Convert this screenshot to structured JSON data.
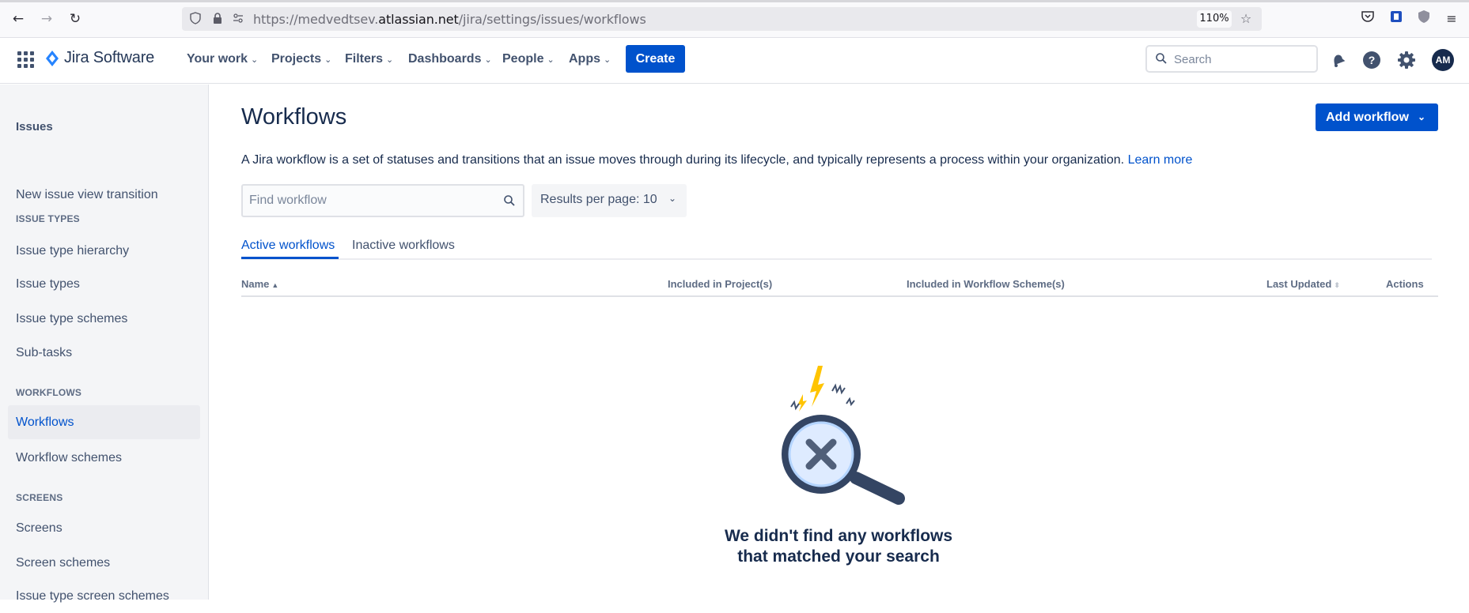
{
  "browser": {
    "url_prefix": "https://medvedtsev.",
    "url_domain": "atlassian.net",
    "url_path": "/jira/settings/issues/workflows",
    "zoom": "110%"
  },
  "topnav": {
    "logo_text": "Jira Software",
    "items": [
      {
        "label": "Your work"
      },
      {
        "label": "Projects"
      },
      {
        "label": "Filters"
      },
      {
        "label": "Dashboards"
      },
      {
        "label": "People"
      },
      {
        "label": "Apps"
      }
    ],
    "create_label": "Create",
    "search_placeholder": "Search",
    "avatar_initials": "AM"
  },
  "sidebar": {
    "title": "Issues",
    "items": [
      {
        "label": "New issue view transition"
      },
      {
        "label": "Issue type hierarchy"
      },
      {
        "label": "Issue types"
      },
      {
        "label": "Issue type schemes"
      },
      {
        "label": "Sub-tasks"
      },
      {
        "label": "Workflows"
      },
      {
        "label": "Workflow schemes"
      },
      {
        "label": "Screens"
      },
      {
        "label": "Screen schemes"
      },
      {
        "label": "Issue type screen schemes"
      }
    ],
    "sections": [
      "ISSUE TYPES",
      "WORKFLOWS",
      "SCREENS"
    ]
  },
  "main": {
    "title": "Workflows",
    "add_button": "Add workflow",
    "description": "A Jira workflow is a set of statuses and transitions that an issue moves through during its lifecycle, and typically represents a process within your organization.",
    "learn_more": "Learn more",
    "find_placeholder": "Find workflow",
    "results_per_page": "Results per page: 10",
    "tabs": [
      {
        "label": "Active workflows"
      },
      {
        "label": "Inactive workflows"
      }
    ],
    "columns": [
      {
        "label": "Name"
      },
      {
        "label": "Included in Project(s)"
      },
      {
        "label": "Included in Workflow Scheme(s)"
      },
      {
        "label": "Last Updated"
      },
      {
        "label": "Actions"
      }
    ],
    "empty_line1": "We didn't find any workflows",
    "empty_line2": "that matched your search"
  }
}
